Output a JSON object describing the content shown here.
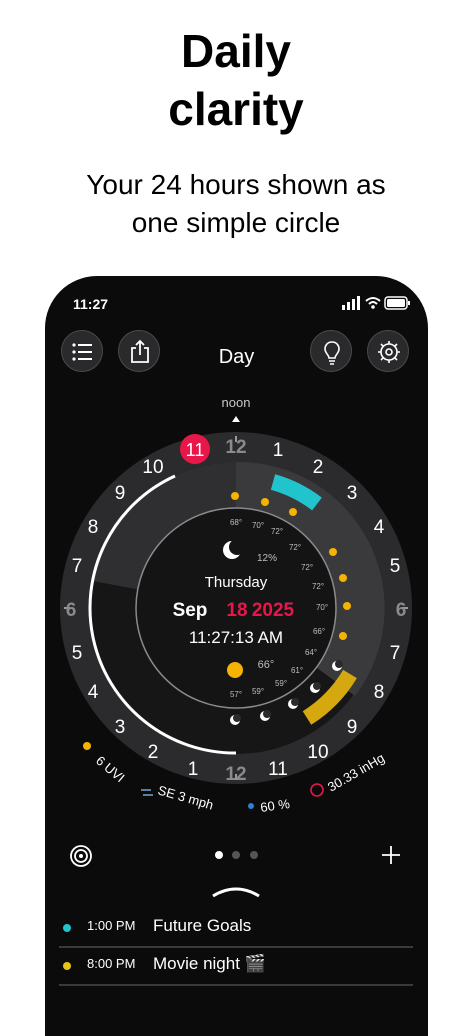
{
  "headline": {
    "line1": "Daily",
    "line2": "clarity"
  },
  "subhead": {
    "line1": "Your 24 hours shown as",
    "line2": "one simple circle"
  },
  "status_bar": {
    "time": "11:27"
  },
  "header": {
    "title": "Day"
  },
  "dial": {
    "noon_label": "noon",
    "hours_top_right": [
      "12",
      "1",
      "2",
      "3",
      "4",
      "5",
      "6",
      "7",
      "8",
      "9",
      "10",
      "11",
      "12"
    ],
    "hours_left": [
      "11",
      "10",
      "9",
      "8",
      "7",
      "6",
      "5",
      "4",
      "3",
      "2",
      "1"
    ],
    "current_hour_badge": "11",
    "center": {
      "day": "Thursday",
      "month": "Sep",
      "day_num": "18",
      "year": "2025",
      "time": "11:27:13 AM",
      "precip": "12%"
    },
    "temps": [
      "68°",
      "70°",
      "72°",
      "72°",
      "72°",
      "72°",
      "70°",
      "66°",
      "64°",
      "61°",
      "59°",
      "57°",
      "59°",
      "66°"
    ],
    "stats": {
      "uvi": "6 UVI",
      "wind": "SE 3 mph",
      "humidity": "60 %",
      "pressure": "30.33 inHg"
    },
    "colors": {
      "accent": "#e8174a",
      "teal": "#21c4cc",
      "gold": "#d4a80e"
    }
  },
  "events": [
    {
      "time": "1:00 PM",
      "title": "Future Goals",
      "color": "#21c4cc"
    },
    {
      "time": "8:00 PM",
      "title": "Movie night 🎬",
      "color": "#e6c31a"
    }
  ]
}
